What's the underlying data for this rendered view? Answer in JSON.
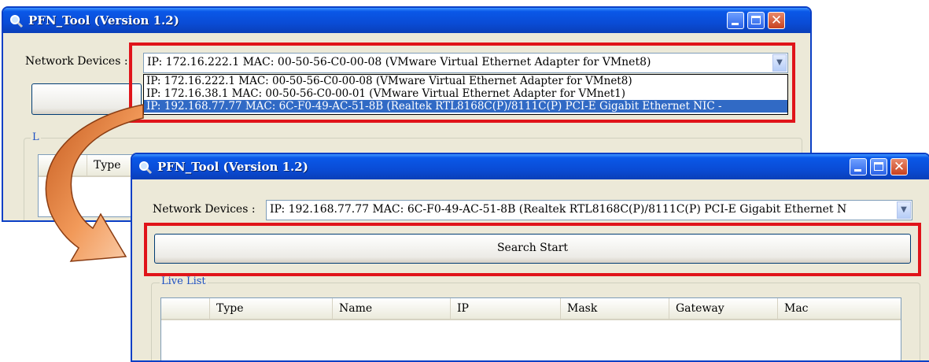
{
  "back_window": {
    "title": "PFN_Tool (Version 1.2)",
    "network_label": "Network Devices :",
    "combo_value": "IP: 172.16.222.1  MAC: 00-50-56-C0-00-08 (VMware Virtual Ethernet Adapter for VMnet8)",
    "dropdown_items": [
      "IP: 172.16.222.1  MAC: 00-50-56-C0-00-08 (VMware Virtual Ethernet Adapter for VMnet8)",
      "IP: 172.16.38.1  MAC: 00-50-56-C0-00-01 (VMware Virtual Ethernet Adapter for VMnet1)",
      "IP: 192.168.77.77  MAC: 6C-F0-49-AC-51-8B (Realtek RTL8168C(P)/8111C(P) PCI-E Gigabit Ethernet NIC -"
    ],
    "selected_index": 2,
    "group_label": "L",
    "column_type": "Type"
  },
  "front_window": {
    "title": "PFN_Tool (Version 1.2)",
    "network_label": "Network Devices :",
    "combo_value": "IP: 192.168.77.77  MAC: 6C-F0-49-AC-51-8B (Realtek RTL8168C(P)/8111C(P) PCI-E Gigabit Ethernet N",
    "search_button": "Search Start",
    "group_label": "Live List",
    "columns": [
      "Type",
      "Name",
      "IP",
      "Mask",
      "Gateway",
      "Mac"
    ]
  },
  "colors": {
    "highlight": "#e0141a",
    "selection": "#316ac5",
    "arrow_fill": "#e87a3a"
  },
  "icons": {
    "window_icon": "magnifier-icon",
    "minimize": "minimize-icon",
    "maximize": "maximize-icon",
    "close": "close-icon",
    "combo_arrow": "chevron-down-icon",
    "transition": "curved-arrow-icon"
  }
}
